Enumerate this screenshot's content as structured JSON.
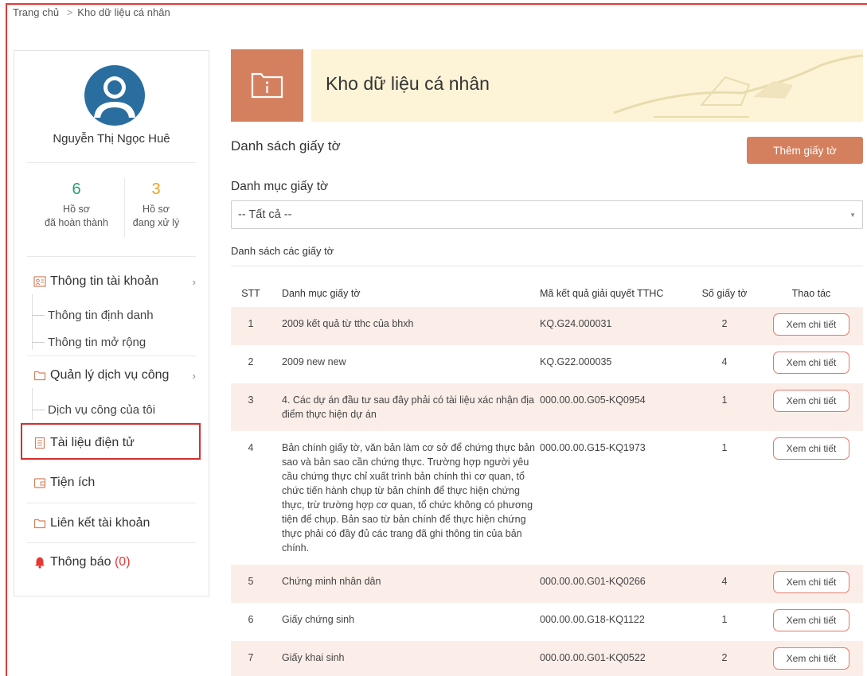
{
  "breadcrumb": {
    "home": "Trang chủ",
    "separator": ">",
    "current": "Kho dữ liệu cá nhân"
  },
  "user": {
    "name": "Nguyễn Thị Ngọc Huê",
    "stats": [
      {
        "value": "6",
        "label_line1": "Hồ sơ",
        "label_line2": "đã hoàn thành",
        "color": "#2e9e6a"
      },
      {
        "value": "3",
        "label_line1": "Hồ sơ",
        "label_line2": "đang xử lý",
        "color": "#f0a020"
      }
    ]
  },
  "menu": {
    "account_info": "Thông tin tài khoản",
    "identity_info": "Thông tin định danh",
    "extended_info": "Thông tin mở rộng",
    "public_services": "Quản lý dịch vụ công",
    "my_services": "Dịch vụ công của tôi",
    "e_documents": "Tài liệu điện tử",
    "utilities": "Tiện ích",
    "linked_accounts": "Liên kết tài khoản",
    "notifications": "Thông báo",
    "notifications_count": "(0)"
  },
  "hero": {
    "title": "Kho dữ liệu cá nhân"
  },
  "main": {
    "section_title": "Danh sách giấy tờ",
    "add_button": "Thêm giấy tờ",
    "filter_label": "Danh mục giấy tờ",
    "filter_value": "-- Tất cả --",
    "list_title": "Danh sách các giấy tờ"
  },
  "table": {
    "headers": [
      "STT",
      "Danh mục giấy tờ",
      "Mã kết quả giải quyết TTHC",
      "Số giấy tờ",
      "Thao tác"
    ],
    "action_label": "Xem chi tiết",
    "rows": [
      {
        "stt": "1",
        "name": "2009 kết quả từ tthc của bhxh",
        "code": "KQ.G24.000031",
        "count": "2"
      },
      {
        "stt": "2",
        "name": "2009 new new",
        "code": "KQ.G22.000035",
        "count": "4"
      },
      {
        "stt": "3",
        "name": "4. Các dự án đầu tư sau đây phải có tài liệu xác nhận địa điểm thực hiện dự án",
        "code": "000.00.00.G05-KQ0954",
        "count": "1"
      },
      {
        "stt": "4",
        "name": "Bản chính giấy tờ, văn bản làm cơ sở để chứng thực bản sao và bản sao cần chứng thực. Trường hợp người yêu cầu chứng thực chỉ xuất trình bản chính thì cơ quan, tổ chức tiến hành chụp từ bản chính để thực hiện chứng thực, trừ trường hợp cơ quan, tổ chức không có phương tiện để chụp. Bản sao từ bản chính để thực hiện chứng thực phải có đầy đủ các trang đã ghi thông tin của bản chính.",
        "code": "000.00.00.G15-KQ1973",
        "count": "1"
      },
      {
        "stt": "5",
        "name": "Chứng minh nhân dân",
        "code": "000.00.00.G01-KQ0266",
        "count": "4"
      },
      {
        "stt": "6",
        "name": "Giấy chứng sinh",
        "code": "000.00.00.G18-KQ1122",
        "count": "1"
      },
      {
        "stt": "7",
        "name": "Giấy khai sinh",
        "code": "000.00.00.G01-KQ0522",
        "count": "2"
      }
    ]
  },
  "colors": {
    "accent": "#d4805e",
    "banner": "#fdf4d8",
    "row_alt": "#fbeee8",
    "highlight_border": "#d32f2f"
  }
}
